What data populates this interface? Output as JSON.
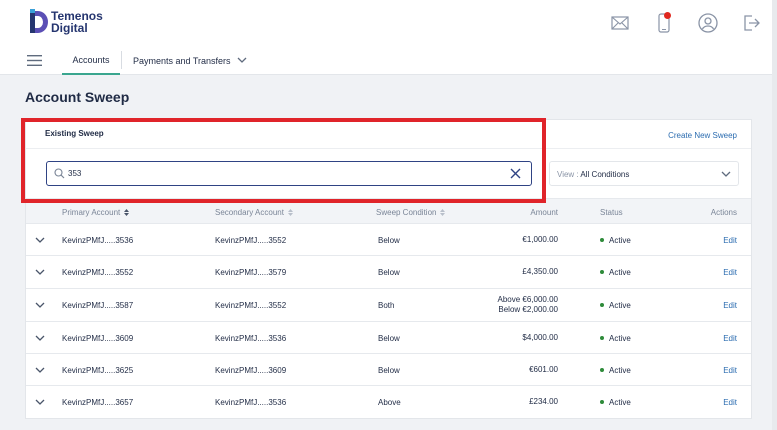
{
  "brand": {
    "line1": "Temenos",
    "line2": "Digital",
    "color": "#25356f"
  },
  "top_icons": [
    "mail-icon",
    "mobile-icon",
    "profile-icon",
    "logout-icon"
  ],
  "nav": {
    "tabs": [
      {
        "label": "Accounts",
        "active": true
      },
      {
        "label": "Payments and Transfers",
        "active": false
      }
    ]
  },
  "page": {
    "title": "Account Sweep"
  },
  "card": {
    "title": "Existing Sweep",
    "create_link": "Create New Sweep",
    "search": {
      "value": "353",
      "placeholder": ""
    },
    "view": {
      "prefix": "View : ",
      "value": "All Conditions"
    }
  },
  "table": {
    "headers": {
      "primary": "Primary Account",
      "secondary": "Secondary Account",
      "condition": "Sweep Condition",
      "amount": "Amount",
      "status": "Status",
      "actions": "Actions"
    },
    "rows": [
      {
        "primary": "KevinzPMfJ.....3536",
        "secondary": "KevinzPMfJ.....3552",
        "condition": "Below",
        "amount": "€1,000.00",
        "amount2": "",
        "status": "Active",
        "action": "Edit"
      },
      {
        "primary": "KevinzPMfJ.....3552",
        "secondary": "KevinzPMfJ.....3579",
        "condition": "Below",
        "amount": "£4,350.00",
        "amount2": "",
        "status": "Active",
        "action": "Edit"
      },
      {
        "primary": "KevinzPMfJ.....3587",
        "secondary": "KevinzPMfJ.....3552",
        "condition": "Both",
        "amount": "Above €6,000.00",
        "amount2": "Below €2,000.00",
        "status": "Active",
        "action": "Edit"
      },
      {
        "primary": "KevinzPMfJ.....3609",
        "secondary": "KevinzPMfJ.....3536",
        "condition": "Below",
        "amount": "$4,000.00",
        "amount2": "",
        "status": "Active",
        "action": "Edit"
      },
      {
        "primary": "KevinzPMfJ.....3625",
        "secondary": "KevinzPMfJ.....3609",
        "condition": "Below",
        "amount": "€601.00",
        "amount2": "",
        "status": "Active",
        "action": "Edit"
      },
      {
        "primary": "KevinzPMfJ.....3657",
        "secondary": "KevinzPMfJ.....3536",
        "condition": "Above",
        "amount": "£234.00",
        "amount2": "",
        "status": "Active",
        "action": "Edit"
      }
    ]
  },
  "colors": {
    "accent": "#3aa68f",
    "link": "#2b6cb0",
    "active_status": "#2e8b3a",
    "highlight": "#e0242a",
    "notification": "#e0271e"
  }
}
